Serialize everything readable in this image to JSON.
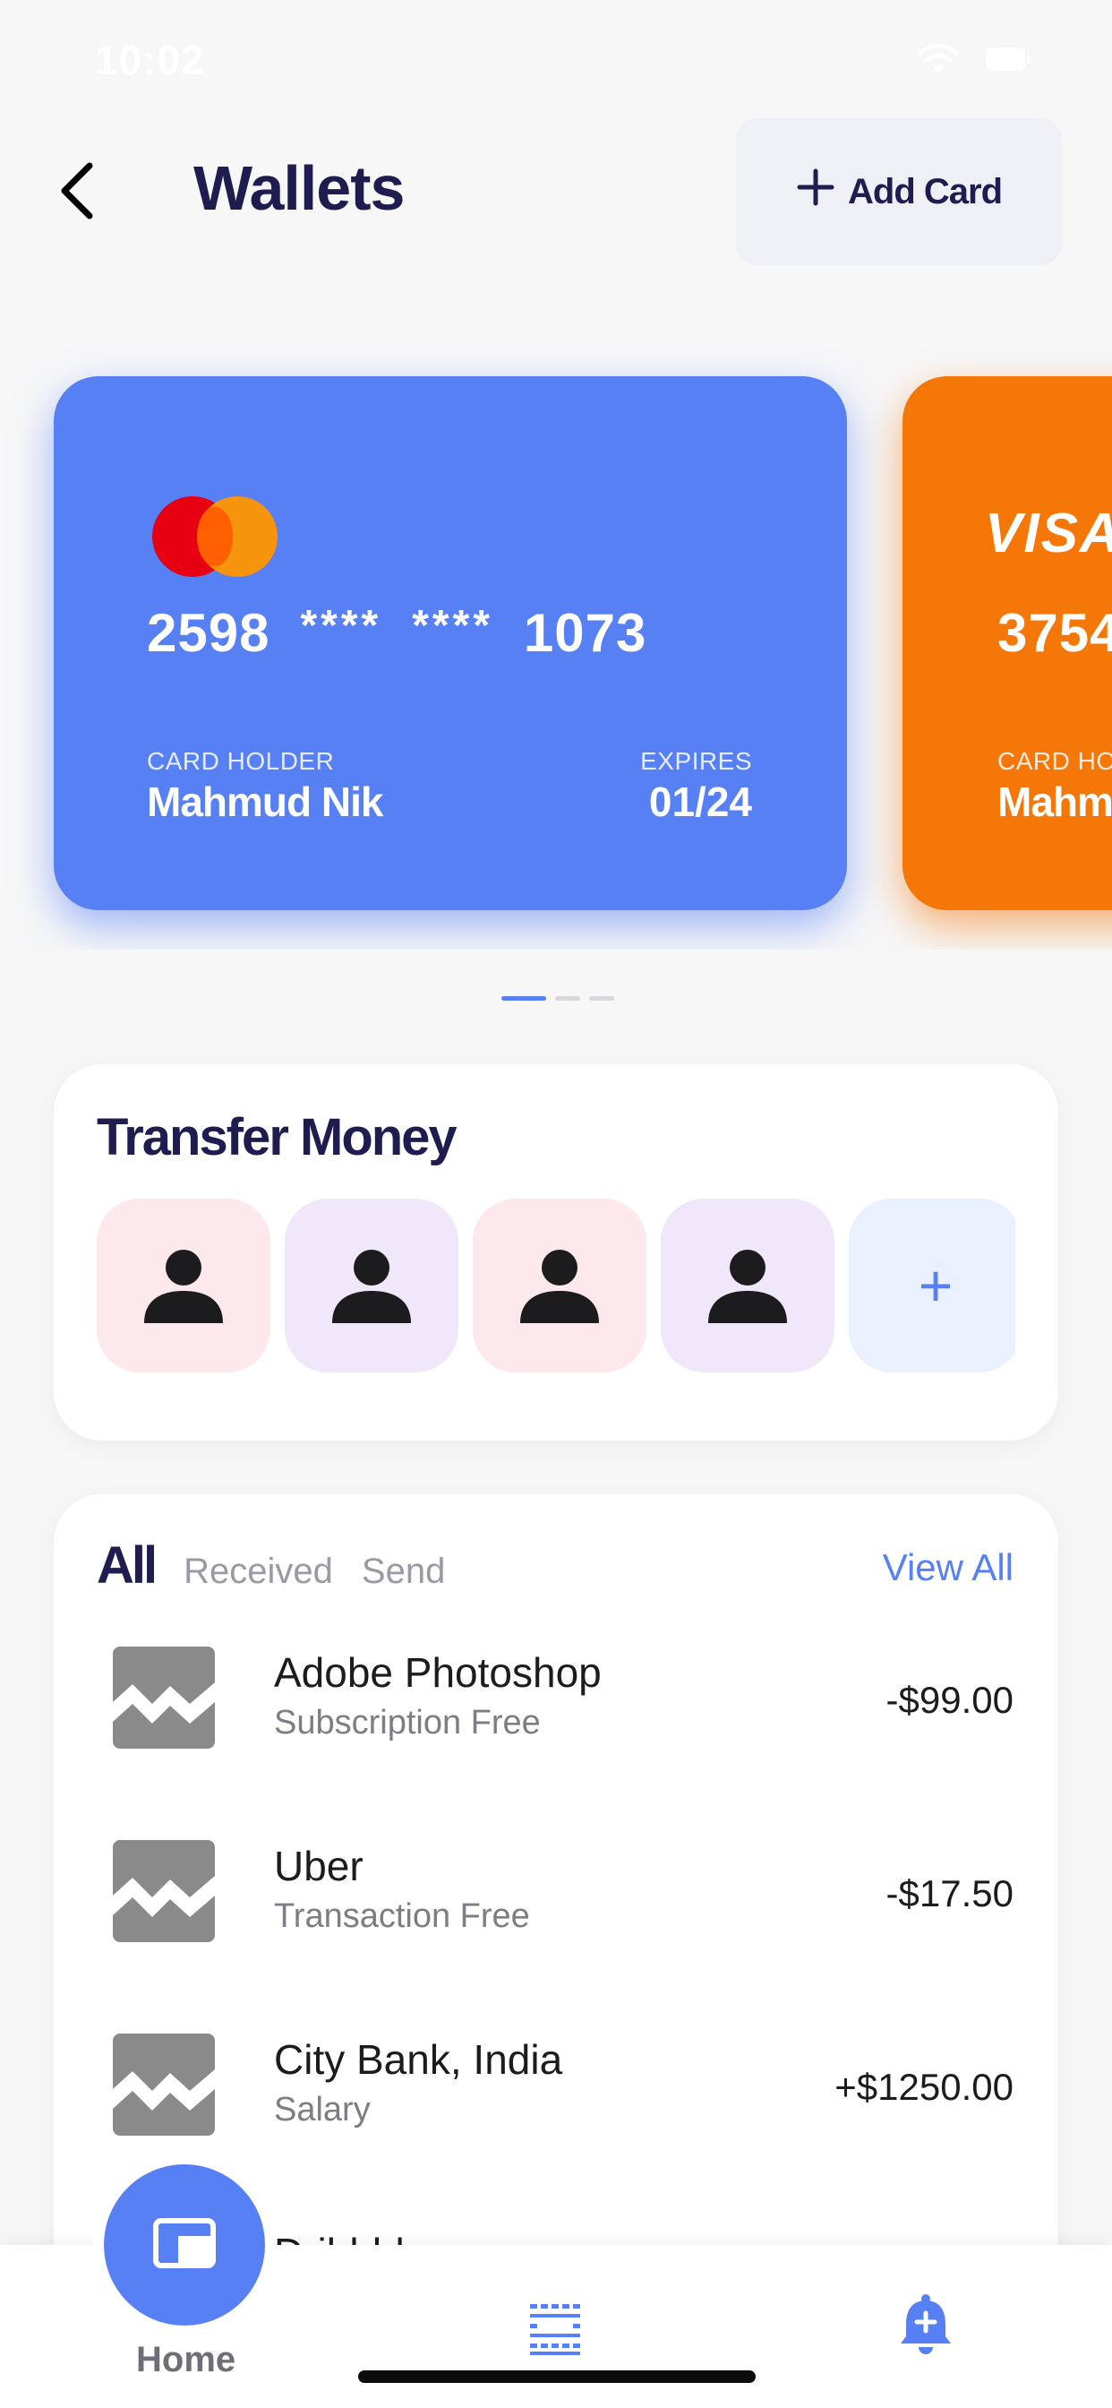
{
  "status_bar": {
    "time": "10:02",
    "icons": [
      "wifi-icon",
      "battery-icon"
    ]
  },
  "header": {
    "back_icon": "chevron-left-icon",
    "title": "Wallets",
    "add_card_label": "Add Card",
    "add_card_icon": "plus-icon"
  },
  "cards": [
    {
      "brand": "mastercard",
      "color": "#5680f4",
      "number_parts": [
        "2598",
        "****",
        "****",
        "1073"
      ],
      "holder_label": "CARD HOLDER",
      "holder": "Mahmud Nik",
      "expires_label": "EXPIRES",
      "expires": "01/24"
    },
    {
      "brand": "VISA",
      "color": "#f47708",
      "number_parts": [
        "3754"
      ],
      "holder_label": "CARD HOL",
      "holder": "Mahm"
    }
  ],
  "pager": {
    "count": 3,
    "active": 0
  },
  "transfer": {
    "title": "Transfer Money",
    "contacts": [
      {
        "icon": "person-icon",
        "bg": "#fde8ec"
      },
      {
        "icon": "person-icon",
        "bg": "#f1e7fb"
      },
      {
        "icon": "person-icon",
        "bg": "#fde8ec"
      },
      {
        "icon": "person-icon",
        "bg": "#f1e7fb"
      }
    ],
    "add_label": "+"
  },
  "transactions": {
    "tabs": [
      "All",
      "Received",
      "Send"
    ],
    "active_tab": "All",
    "view_all": "View All",
    "items": [
      {
        "title": "Adobe Photoshop",
        "subtitle": "Subscription Free",
        "amount": "-$99.00"
      },
      {
        "title": "Uber",
        "subtitle": "Transaction Free",
        "amount": "-$17.50"
      },
      {
        "title": "City Bank, India",
        "subtitle": "Salary",
        "amount": "+$1250.00"
      },
      {
        "title": "Dribbble",
        "subtitle": "",
        "amount": ""
      }
    ]
  },
  "bottom_nav": {
    "home_label": "Home",
    "home_icon": "wallet-icon",
    "middle_icon": "grid-icon",
    "right_icon": "bell-plus-icon",
    "accent": "#5680f4"
  }
}
